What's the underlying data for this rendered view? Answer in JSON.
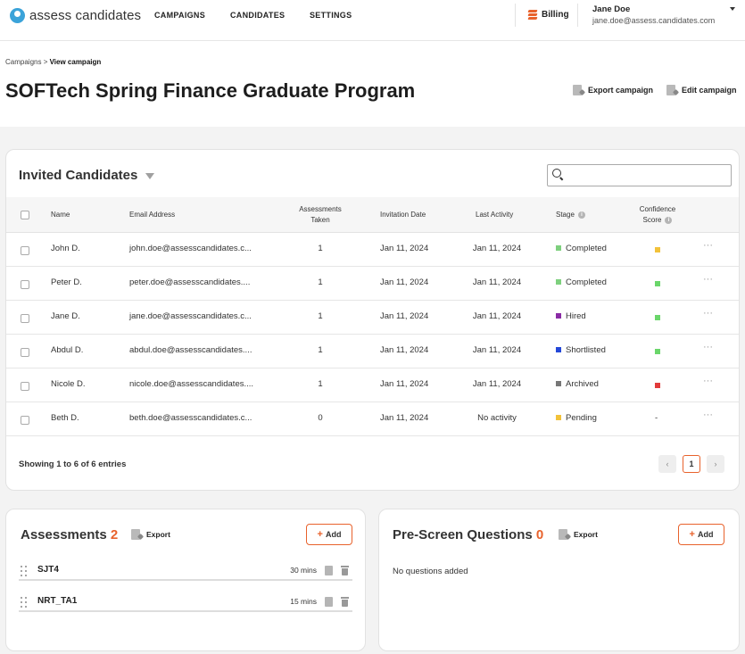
{
  "app": {
    "logo_text": "assess candidates"
  },
  "nav": {
    "campaigns": "CAMPAIGNS",
    "candidates": "CANDIDATES",
    "settings": "SETTINGS"
  },
  "billing": "Billing",
  "user": {
    "name": "Jane Doe",
    "email": "jane.doe@assess.candidates.com"
  },
  "breadcrumb": {
    "parent": "Campaigns",
    "sep": ">",
    "current": "View campaign"
  },
  "page_title": "SOFTech Spring Finance Graduate Program",
  "actions": {
    "export": "Export campaign",
    "edit": "Edit campaign"
  },
  "candidates": {
    "title": "Invited Candidates",
    "search_placeholder": "",
    "columns": {
      "name": "Name",
      "email": "Email Address",
      "assessments_1": "Assessments",
      "assessments_2": "Taken",
      "invited": "Invitation Date",
      "last_activity": "Last Activity",
      "stage": "Stage",
      "confidence_1": "Confidence",
      "confidence_2": "Score"
    },
    "rows": [
      {
        "name": "John D.",
        "email": "john.doe@assesscandidates.c...",
        "taken": "1",
        "invited": "Jan 11, 2024",
        "last": "Jan 11, 2024",
        "stage": "Completed",
        "stage_color": "#7ed07e",
        "score_color": "#f2c23a",
        "score_text": ""
      },
      {
        "name": "Peter D.",
        "email": "peter.doe@assesscandidates....",
        "taken": "1",
        "invited": "Jan 11, 2024",
        "last": "Jan 11, 2024",
        "stage": "Completed",
        "stage_color": "#7ed07e",
        "score_color": "#6ad66a",
        "score_text": ""
      },
      {
        "name": "Jane D.",
        "email": "jane.doe@assesscandidates.c...",
        "taken": "1",
        "invited": "Jan 11, 2024",
        "last": "Jan 11, 2024",
        "stage": "Hired",
        "stage_color": "#8a2ba5",
        "score_color": "#6ad66a",
        "score_text": ""
      },
      {
        "name": "Abdul D.",
        "email": "abdul.doe@assesscandidates....",
        "taken": "1",
        "invited": "Jan 11, 2024",
        "last": "Jan 11, 2024",
        "stage": "Shortlisted",
        "stage_color": "#2448d8",
        "score_color": "#6ad66a",
        "score_text": ""
      },
      {
        "name": "Nicole D.",
        "email": "nicole.doe@assesscandidates....",
        "taken": "1",
        "invited": "Jan 11, 2024",
        "last": "Jan 11, 2024",
        "stage": "Archived",
        "stage_color": "#777777",
        "score_color": "#e23b3b",
        "score_text": ""
      },
      {
        "name": "Beth D.",
        "email": "beth.doe@assesscandidates.c...",
        "taken": "0",
        "invited": "Jan 11, 2024",
        "last": "No activity",
        "stage": "Pending",
        "stage_color": "#f2c23a",
        "score_color": "",
        "score_text": "-"
      }
    ],
    "showing": "Showing 1 to 6 of 6 entries",
    "pager": {
      "prev": "‹",
      "current": "1",
      "next": "›"
    }
  },
  "assessments": {
    "title": "Assessments",
    "count": "2",
    "export": "Export",
    "add": "Add",
    "items": [
      {
        "name": "SJT4",
        "time": "30 mins"
      },
      {
        "name": "NRT_TA1",
        "time": "15 mins"
      }
    ]
  },
  "prescreen": {
    "title": "Pre-Screen Questions",
    "count": "0",
    "export": "Export",
    "add": "Add",
    "empty": "No questions added"
  },
  "colors": {
    "accent": "#e8622c",
    "brand": "#3ba3d9"
  }
}
